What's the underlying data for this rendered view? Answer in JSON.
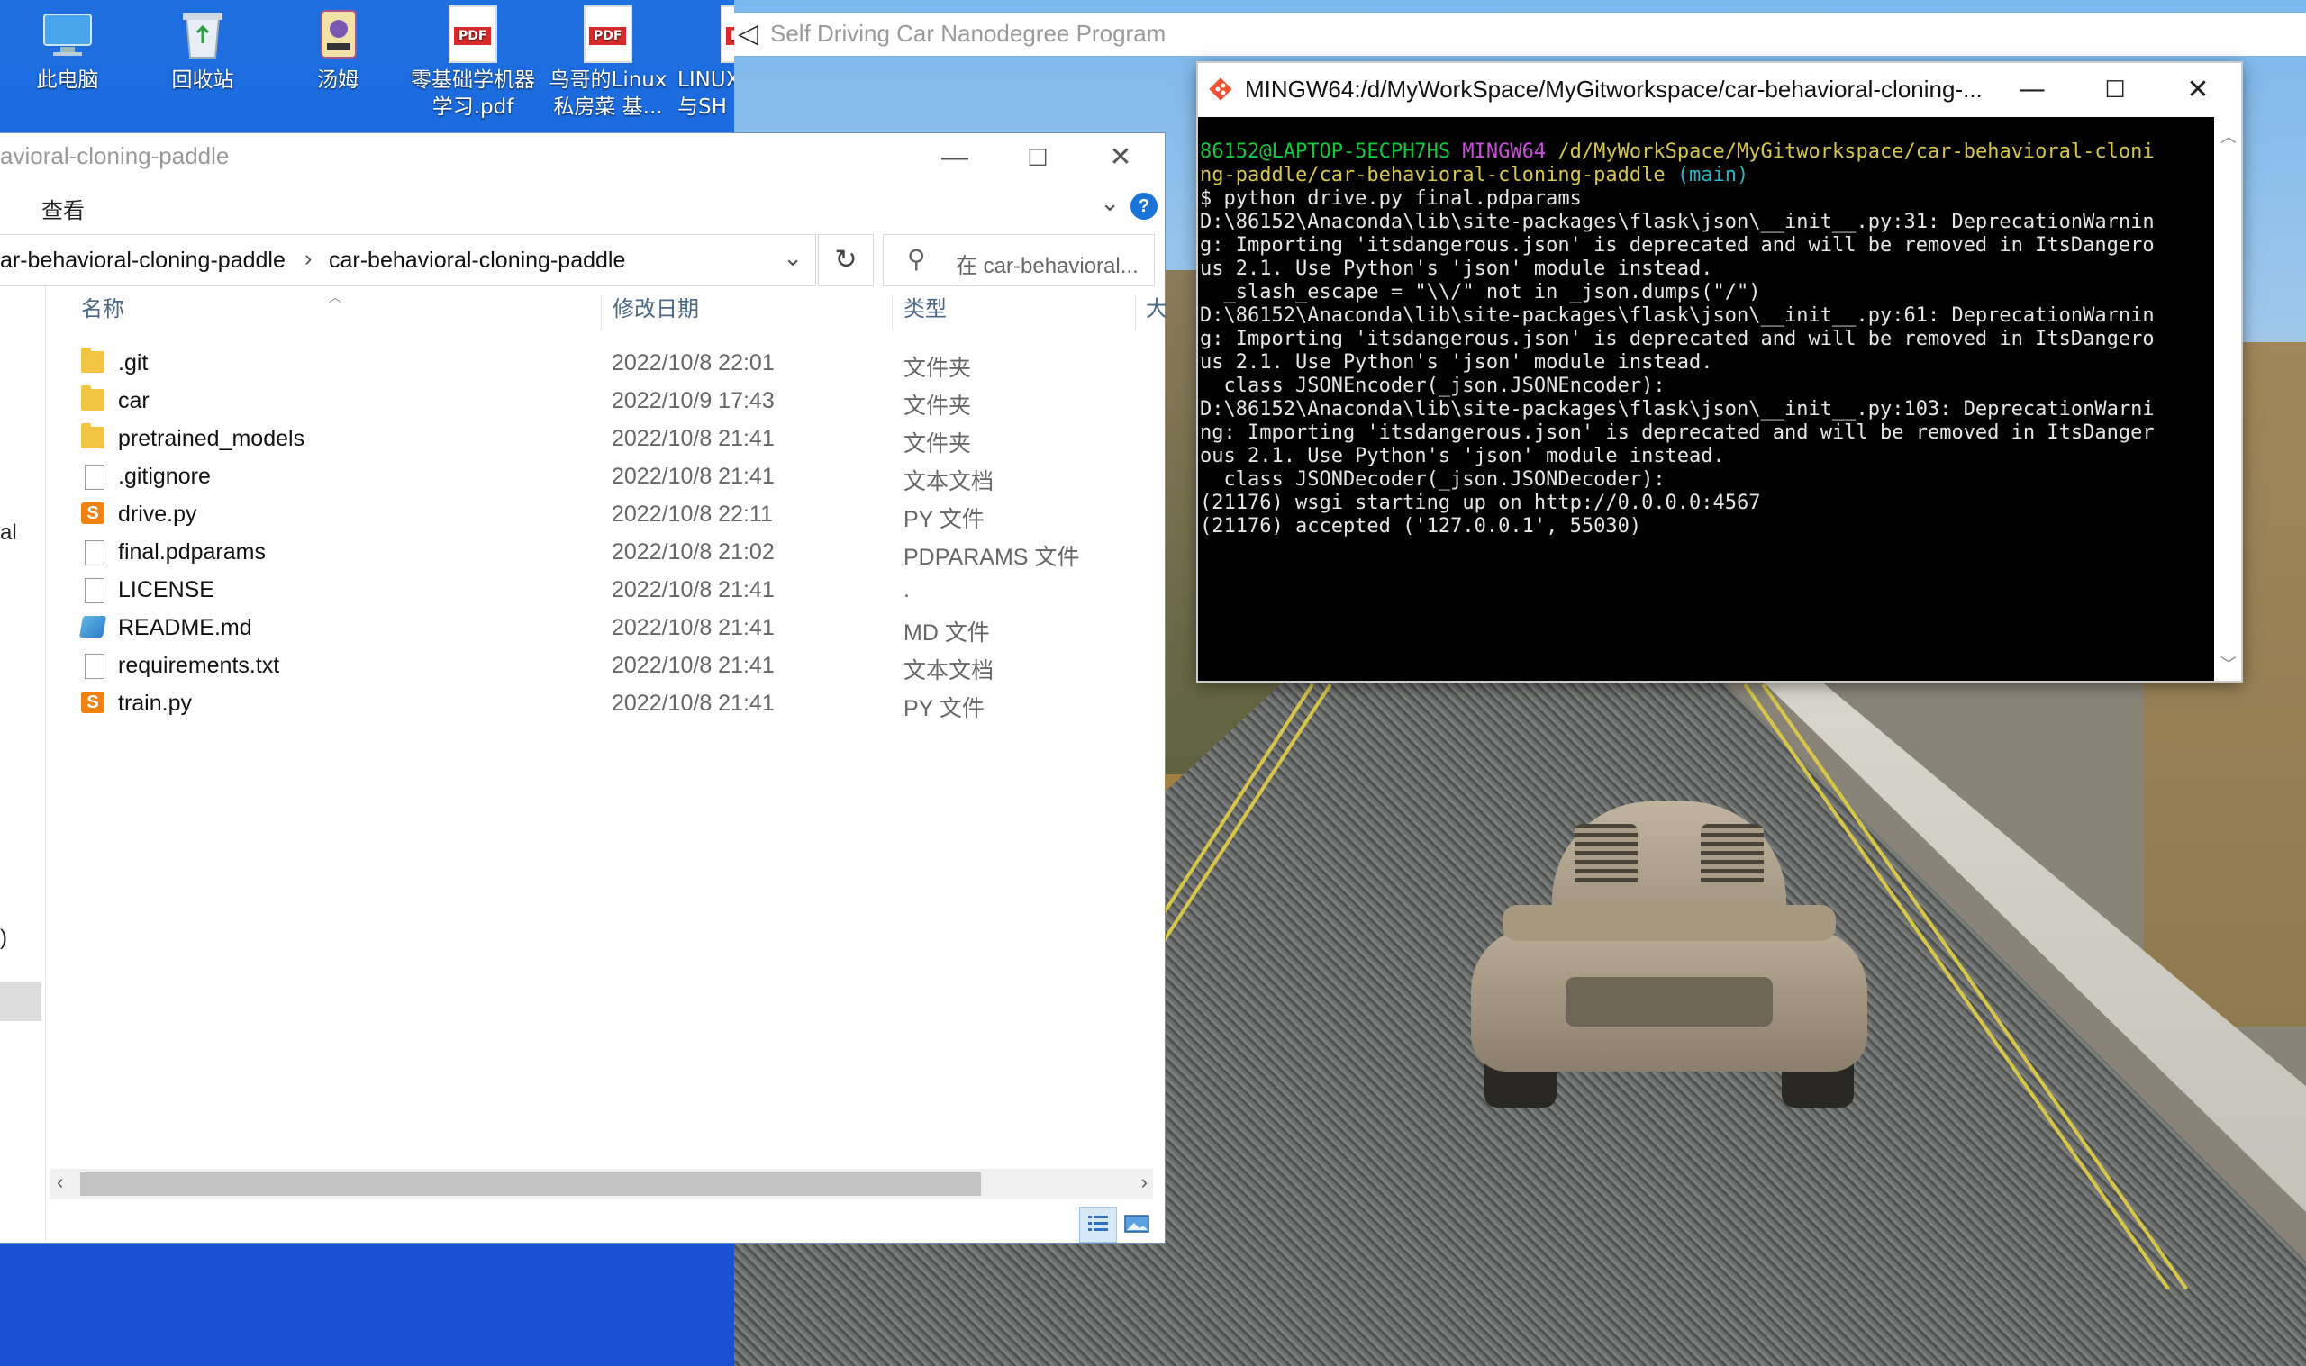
{
  "desktop": {
    "icons": [
      {
        "label1": "此电脑",
        "label2": ""
      },
      {
        "label1": "回收站",
        "label2": ""
      },
      {
        "label1": "汤姆",
        "label2": ""
      },
      {
        "label1": "零基础学机器",
        "label2": "学习.pdf"
      },
      {
        "label1": "鸟哥的Linux",
        "label2": "私房菜  基..."
      },
      {
        "label1": "LINUX",
        "label2": "与SH"
      }
    ],
    "pdf_badge": "PDF"
  },
  "unity": {
    "title": "Self Driving Car Nanodegree Program"
  },
  "explorer": {
    "title": "avioral-cloning-paddle",
    "menu_view": "查看",
    "help": "?",
    "address_parent": "ar-behavioral-cloning-paddle",
    "address_sep": "›",
    "address_current": "car-behavioral-cloning-paddle",
    "dropdown": "⌄",
    "refresh": "↻",
    "search_placeholder": "在 car-behavioral...",
    "columns": {
      "name": "名称",
      "date": "修改日期",
      "type": "类型",
      "size": "大"
    },
    "navpane": {
      "item1": "al",
      "item2": ")"
    },
    "files": [
      {
        "name": ".git",
        "date": "2022/10/8 22:01",
        "type": "文件夹",
        "icon": "folder"
      },
      {
        "name": "car",
        "date": "2022/10/9 17:43",
        "type": "文件夹",
        "icon": "folder"
      },
      {
        "name": "pretrained_models",
        "date": "2022/10/8 21:41",
        "type": "文件夹",
        "icon": "folder"
      },
      {
        "name": ".gitignore",
        "date": "2022/10/8 21:41",
        "type": "文本文档",
        "icon": "doc"
      },
      {
        "name": "drive.py",
        "date": "2022/10/8 22:11",
        "type": "PY 文件",
        "icon": "py"
      },
      {
        "name": "final.pdparams",
        "date": "2022/10/8 21:02",
        "type": "PDPARAMS 文件",
        "icon": "doc"
      },
      {
        "name": "LICENSE",
        "date": "2022/10/8 21:41",
        "type": ".",
        "icon": "doc"
      },
      {
        "name": "README.md",
        "date": "2022/10/8 21:41",
        "type": "MD 文件",
        "icon": "md"
      },
      {
        "name": "requirements.txt",
        "date": "2022/10/8 21:41",
        "type": "文本文档",
        "icon": "doc"
      },
      {
        "name": "train.py",
        "date": "2022/10/8 21:41",
        "type": "PY 文件",
        "icon": "py"
      }
    ]
  },
  "terminal": {
    "title": "MINGW64:/d/MyWorkSpace/MyGitworkspace/car-behavioral-cloning-...",
    "prompt_user": "86152@LAPTOP-5ECPH7HS",
    "prompt_env": "MINGW64",
    "prompt_path1": "/d/MyWorkSpace/MyGitworkspace/car-behavioral-cloni",
    "prompt_path2": "ng-paddle/car-behavioral-cloning-paddle",
    "prompt_branch": "(main)",
    "command": "$ python drive.py final.pdparams",
    "output": [
      "D:\\86152\\Anaconda\\lib\\site-packages\\flask\\json\\__init__.py:31: DeprecationWarnin",
      "g: Importing 'itsdangerous.json' is deprecated and will be removed in ItsDangero",
      "us 2.1. Use Python's 'json' module instead.",
      "  _slash_escape = \"\\\\/\" not in _json.dumps(\"/\")",
      "D:\\86152\\Anaconda\\lib\\site-packages\\flask\\json\\__init__.py:61: DeprecationWarnin",
      "g: Importing 'itsdangerous.json' is deprecated and will be removed in ItsDangero",
      "us 2.1. Use Python's 'json' module instead.",
      "  class JSONEncoder(_json.JSONEncoder):",
      "D:\\86152\\Anaconda\\lib\\site-packages\\flask\\json\\__init__.py:103: DeprecationWarni",
      "ng: Importing 'itsdangerous.json' is deprecated and will be removed in ItsDanger",
      "ous 2.1. Use Python's 'json' module instead.",
      "  class JSONDecoder(_json.JSONDecoder):",
      "(21176) wsgi starting up on http://0.0.0.0:4567",
      "(21176) accepted ('127.0.0.1', 55030)"
    ]
  },
  "window_buttons": {
    "minimize": "—",
    "maximize": "☐",
    "close": "✕"
  },
  "colors": {
    "desktop": "#1f6fe0",
    "terminal_bg": "#000000",
    "prompt_green": "#12c93b",
    "prompt_magenta": "#c84fd8",
    "prompt_yellow": "#d6c64a",
    "help_blue": "#1a73d9"
  }
}
